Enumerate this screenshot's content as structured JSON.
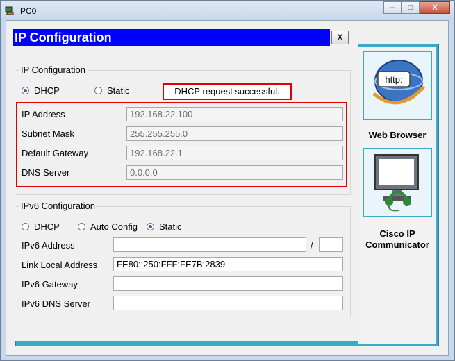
{
  "window": {
    "title": "PC0",
    "minimize": "–",
    "maximize": "□",
    "close": "X"
  },
  "dialog": {
    "title": "IP Configuration",
    "close": "X"
  },
  "ipv4": {
    "legend": "IP Configuration",
    "dhcp_label": "DHCP",
    "static_label": "Static",
    "selected": "DHCP",
    "status": "DHCP request successful.",
    "ip_label": "IP Address",
    "ip_value": "192.168.22.100",
    "mask_label": "Subnet Mask",
    "mask_value": "255.255.255.0",
    "gateway_label": "Default Gateway",
    "gateway_value": "192.168.22.1",
    "dns_label": "DNS Server",
    "dns_value": "0.0.0.0"
  },
  "ipv6": {
    "legend": "IPv6 Configuration",
    "dhcp_label": "DHCP",
    "auto_label": "Auto Config",
    "static_label": "Static",
    "selected": "Static",
    "address_label": "IPv6 Address",
    "address_value": "",
    "prefix_slash": "/",
    "prefix_value": "",
    "link_local_label": "Link Local Address",
    "link_local_value": "FE80::250:FFF:FE7B:2839",
    "gateway_label": "IPv6 Gateway",
    "gateway_value": "",
    "dns_label": "IPv6 DNS Server",
    "dns_value": ""
  },
  "apps": [
    {
      "label": "Web Browser",
      "icon": "web-browser-icon",
      "icon_text": "http:"
    },
    {
      "label": "Cisco IP Communicator",
      "icon": "ip-communicator-icon"
    }
  ],
  "colors": {
    "title_bar": "#0000ff",
    "highlight": "#e00000",
    "desktop": "#3ca9c8"
  }
}
